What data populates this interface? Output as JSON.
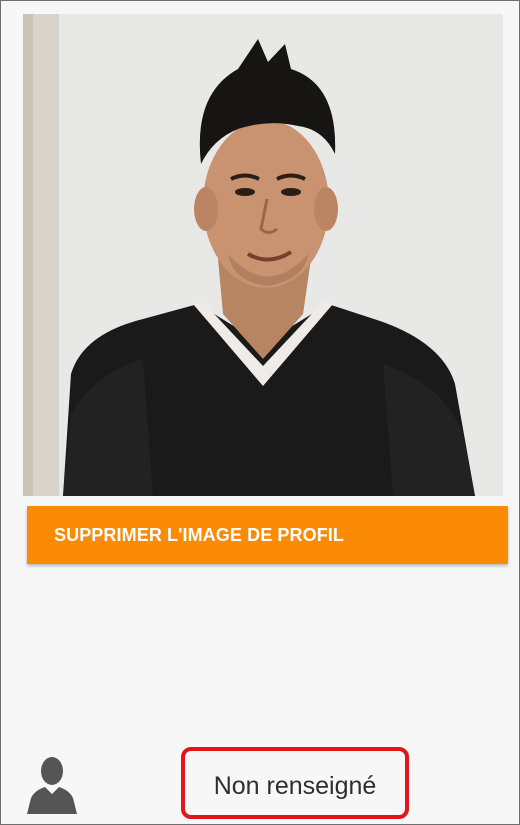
{
  "profile": {
    "photo_icon": "profile-photo",
    "remove_image_label": "SUPPRIMER L'IMAGE DE PROFIL",
    "remove_button_color": "#fb8a05"
  },
  "user": {
    "avatar_icon": "user-silhouette-icon",
    "status_value": "Non renseigné",
    "highlight_color": "#e3151a"
  }
}
